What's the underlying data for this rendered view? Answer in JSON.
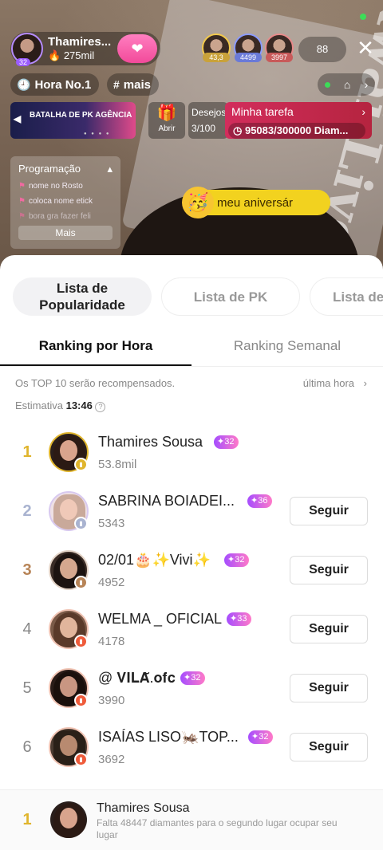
{
  "stream": {
    "host_name": "Thamires...",
    "host_level": "32",
    "host_fans": "275mil",
    "viewers": [
      {
        "level": "43,3",
        "color": "#c9a23a"
      },
      {
        "level": "4499",
        "color": "#6a7ad8"
      },
      {
        "level": "3997",
        "color": "#c85a5a"
      }
    ],
    "viewer_count": "88",
    "hour_rank": "Hora No.1",
    "more_chip": "mais",
    "pk_banner": "BATALHA DE PK AGÊNCIA",
    "gift_label": "Abrir",
    "wish_label": "Desejos",
    "wish_progress": "3/100",
    "task_title": "Minha tarefa",
    "task_progress": "95083/300000 Diam...",
    "watermark": "Kwai Live",
    "program": {
      "title": "Programação",
      "items": [
        "nome no Rosto",
        "coloca nome etick",
        "bora gra fazer feli"
      ],
      "more": "Mais"
    },
    "birthday": "meu aniversár"
  },
  "ranking": {
    "segments": [
      "Lista de Popularidade",
      "Lista de PK",
      "Lista de"
    ],
    "tabs": [
      "Ranking por Hora",
      "Ranking Semanal"
    ],
    "notice": "Os TOP 10 serão recompensados.",
    "last_hour": "última hora",
    "estimate_label": "Estimativa",
    "estimate_time": "13:46",
    "follow_label": "Seguir",
    "rows": [
      {
        "rank": "1",
        "name": "Thamires Sousa",
        "level": "32",
        "score": "53.8mil",
        "follow": false,
        "medal": "#e0b52d"
      },
      {
        "rank": "2",
        "name": "SABRINA  BOIADEI...",
        "level": "36",
        "score": "5343",
        "follow": true,
        "medal": "#a9b3d0"
      },
      {
        "rank": "3",
        "name": "02/01🎂✨Vivi✨",
        "level": "32",
        "score": "4952",
        "follow": true,
        "medal": "#b78457"
      },
      {
        "rank": "4",
        "name": "WELMA _ OFICIAL",
        "level": "33",
        "score": "4178",
        "follow": true,
        "medal": "#ef5b3a"
      },
      {
        "rank": "5",
        "name": "@ 𝐕𝐈𝐋𝐀̆.𝐨𝐟𝐜",
        "level": "32",
        "score": "3990",
        "follow": true,
        "medal": "#ef5b3a"
      },
      {
        "rank": "6",
        "name": "ISAÍAS LISO🦗TOP...",
        "level": "32",
        "score": "3692",
        "follow": true,
        "medal": "#ef5b3a"
      }
    ],
    "my": {
      "rank": "1",
      "name": "Thamires Sousa",
      "note": "Falta 48447 diamantes para o segundo lugar ocupar seu lugar"
    }
  },
  "colors": {
    "gold": "#e0b52d",
    "silver": "#a9b3d0",
    "bronze": "#b78457",
    "level_badge": "#a54dff",
    "task": "#d22d5c"
  }
}
